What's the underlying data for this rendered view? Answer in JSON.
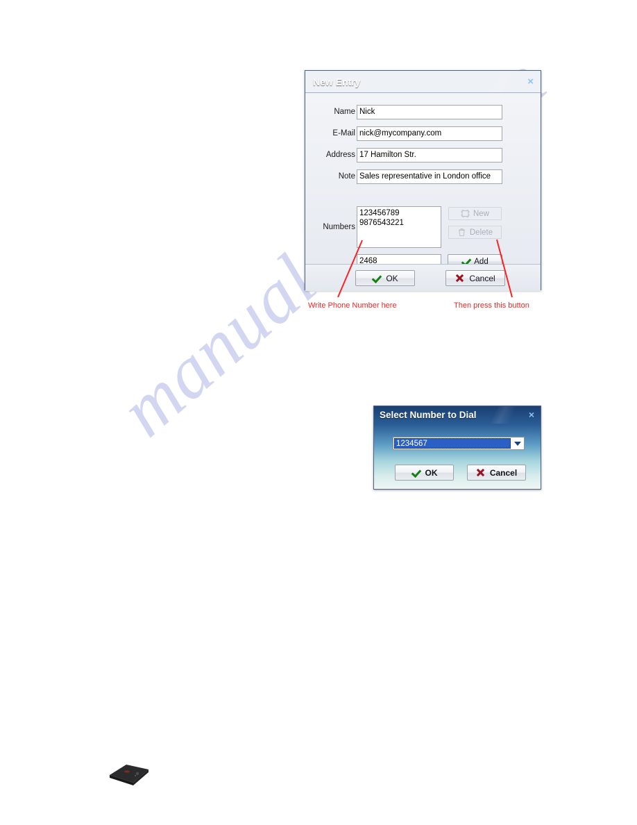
{
  "page": {
    "background": "#ffffff",
    "watermark_text": "manualshive.com",
    "watermark_color": "#b9bde8"
  },
  "new_entry_dialog": {
    "title": "New Entry",
    "close_label": "×",
    "title_bar_color": "#1b4079",
    "fields": [
      {
        "label": "Name",
        "value": "Nick"
      },
      {
        "label": "E-Mail",
        "value": "nick@mycompany.com"
      },
      {
        "label": "Address",
        "value": "17 Hamilton Str."
      },
      {
        "label": "Note",
        "value": "Sales representative in London office"
      }
    ],
    "numbers": {
      "label": "Numbers",
      "items": [
        "123456789",
        "9876543221"
      ],
      "entry_value": "2468"
    },
    "side_buttons": [
      {
        "label": "New",
        "icon": "new-icon",
        "enabled": false
      },
      {
        "label": "Delete",
        "icon": "trash-icon",
        "enabled": false
      },
      {
        "label": "Add",
        "icon": "check-icon",
        "enabled": true
      }
    ],
    "footer_buttons": [
      {
        "label": "OK",
        "icon": "check-icon"
      },
      {
        "label": "Cancel",
        "icon": "x-icon"
      }
    ]
  },
  "annotations": [
    {
      "text": "Write Phone Number here",
      "color": "#fb2222"
    },
    {
      "text": "Then press this button",
      "color": "#fb2222"
    }
  ],
  "select_dialog": {
    "title": "Select Number to Dial",
    "close_label": "×",
    "combo_value": "1234567",
    "buttons": [
      {
        "label": "OK",
        "icon": "check-icon"
      },
      {
        "label": "Cancel",
        "icon": "x-icon"
      }
    ]
  }
}
